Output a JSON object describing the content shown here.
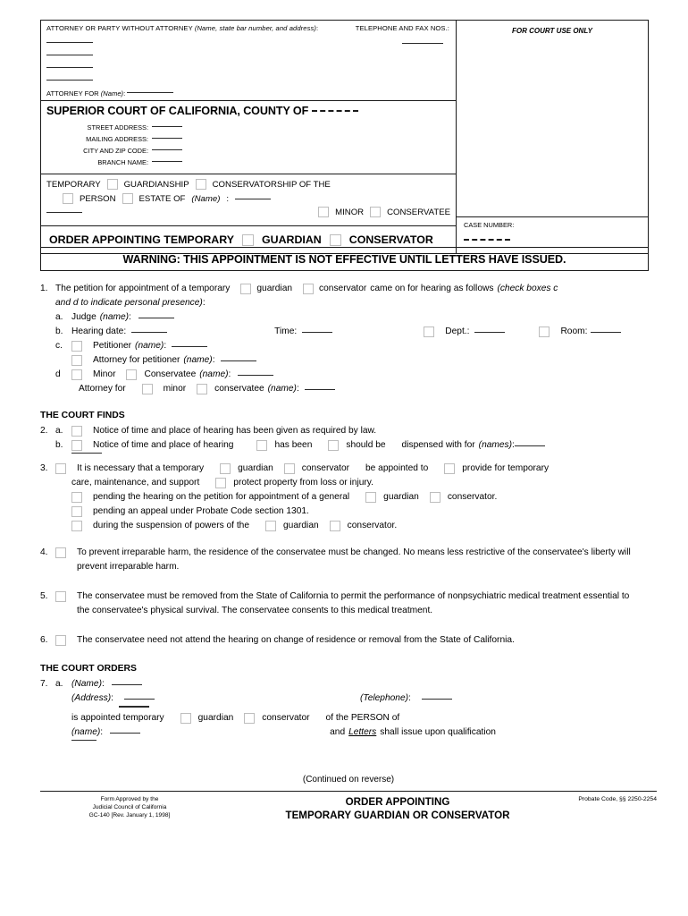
{
  "header": {
    "attorney_caption": "ATTORNEY OR PARTY WITHOUT ATTORNEY (Name, state bar number, and address):",
    "attorney_caption_plain": "ATTORNEY OR PARTY WITHOUT ATTORNEY ",
    "attorney_caption_italic": "(Name, state bar number, and address)",
    "telephone_caption": "TELEPHONE AND FAX NOS.:",
    "attorney_for_label": "ATTORNEY FOR ",
    "attorney_for_italic": "(Name)",
    "court_title": "SUPERIOR COURT OF CALIFORNIA, COUNTY OF",
    "address_rows": [
      "STREET ADDRESS:",
      "MAILING ADDRESS:",
      "CITY AND ZIP CODE:",
      "BRANCH NAME:"
    ],
    "court_use_only": "FOR COURT USE ONLY",
    "case_number_label": "CASE NUMBER:"
  },
  "temporary": {
    "temporary": "TEMPORARY",
    "guardianship": "GUARDIANSHIP",
    "conservatorship_of_the": "CONSERVATORSHIP OF THE",
    "person": "PERSON",
    "estate_of": "ESTATE OF",
    "name_italic": "(Name)",
    "minor": "MINOR",
    "conservatee": "CONSERVATEE"
  },
  "order_bar": {
    "title": "ORDER APPOINTING TEMPORARY",
    "guardian": "GUARDIAN",
    "conservator": "CONSERVATOR"
  },
  "warning": {
    "text": "WARNING: THIS APPOINTMENT IS NOT EFFECTIVE UNTIL LETTERS HAVE ISSUED."
  },
  "item1": {
    "num": "1.",
    "t1": "The petition for appointment of a temporary",
    "guardian": "guardian",
    "conservator": "conservator",
    "t2": "came on for hearing as follows",
    "italic_note1": "(check boxes c",
    "italic_note2": "and d to indicate personal presence)",
    "colon": ":",
    "a": "a.",
    "a_label": "Judge",
    "a_italic": "(name)",
    "b": "b.",
    "b_label": "Hearing date:",
    "b_time": "Time:",
    "b_dept": "Dept.:",
    "b_room": "Room:",
    "c": "c.",
    "c_label": "Petitioner",
    "c_italic": "(name)",
    "c2_label": "Attorney for petitioner",
    "c2_italic": "(name)",
    "d": "d",
    "d_minor": "Minor",
    "d_conservatee": "Conservatee",
    "d_italic": "(name)",
    "d2_label": "Attorney for",
    "d2_minor": "minor",
    "d2_conservatee": "conservatee",
    "d2_italic": "(name)"
  },
  "court_finds": {
    "heading": "THE COURT FINDS",
    "item2_num": "2.",
    "a": "a.",
    "a_text": "Notice of time and place of hearing has been given as required by law.",
    "b": "b.",
    "b_text1": "Notice of time and place of hearing",
    "b_hasbeen": "has been",
    "b_shouldbe": "should be",
    "b_text2": "dispensed with for",
    "b_italic": "(names)",
    "item3_num": "3.",
    "i3_t1": "It is necessary that a temporary",
    "i3_guardian": "guardian",
    "i3_conservator": "conservator",
    "i3_t2": "be appointed to",
    "i3_t3": "provide for temporary",
    "i3_t4": "care, maintenance, and support",
    "i3_t5": "protect property from loss or injury.",
    "i3_l1": "pending the hearing on the petition for appointment of a general",
    "i3_l1_guardian": "guardian",
    "i3_l1_conservator": "conservator.",
    "i3_l2": "pending an appeal under Probate Code section 1301.",
    "i3_l3": "during the suspension of powers of the",
    "i3_l3_guardian": "guardian",
    "i3_l3_conservator": "conservator.",
    "item4_num": "4.",
    "item4_text": "To prevent irreparable harm, the residence of the conservatee must be changed. No means less restrictive of the conservatee's liberty will prevent irreparable harm.",
    "item5_num": "5.",
    "item5_text": "The conservatee must be removed from the State of California to permit the performance of nonpsychiatric medical treatment essential to the conservatee's physical survival. The conservatee consents to this medical treatment.",
    "item6_num": "6.",
    "item6_text": "The conservatee need not attend the hearing on change of residence or removal from the State of California."
  },
  "court_orders": {
    "heading": "THE COURT ORDERS",
    "item7_num": "7.",
    "a": "a.",
    "name_italic": "(Name)",
    "address_italic": "(Address)",
    "telephone_italic": "(Telephone)",
    "appointed_text": "is appointed temporary",
    "guardian": "guardian",
    "conservator": "conservator",
    "of_person": "of the PERSON of",
    "name2_italic": "(name)",
    "and": "and",
    "letters": "Letters",
    "shall_issue": "shall issue upon qualification"
  },
  "footer": {
    "continued": "(Continued on reverse)",
    "left_line1": "Form Approved by the",
    "left_line2": "Judicial Council of California",
    "left_line3": "GC-140 [Rev. January 1, 1998]",
    "center_line1": "ORDER APPOINTING",
    "center_line2": "TEMPORARY GUARDIAN OR CONSERVATOR",
    "right": "Probate Code, §§ 2250-2254"
  },
  "colors": {
    "rule": "#1a1a1a",
    "checkbox_border": "#bdbdbd",
    "fill_line": "#2b2b2b"
  }
}
